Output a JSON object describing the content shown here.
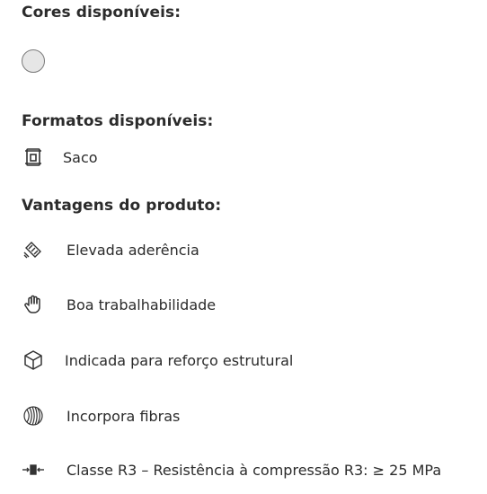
{
  "colors_section": {
    "title": "Cores disponíveis:",
    "swatches": [
      {
        "color": "#e6e6e6"
      }
    ]
  },
  "formats_section": {
    "title": "Formatos disponíveis:",
    "items": [
      {
        "icon": "bag-icon",
        "label": "Saco"
      }
    ]
  },
  "advantages_section": {
    "title": "Vantagens do produto:",
    "items": [
      {
        "icon": "adhesion-icon",
        "label": "Elevada aderência"
      },
      {
        "icon": "hand-icon",
        "label": "Boa trabalhabilidade"
      },
      {
        "icon": "cube-icon",
        "label": "Indicada para reforço estrutural"
      },
      {
        "icon": "fibers-icon",
        "label": "Incorpora fibras"
      },
      {
        "icon": "compression-icon",
        "label": "Classe R3 – Resistência à compressão R3: ≥ 25 MPa"
      }
    ]
  }
}
